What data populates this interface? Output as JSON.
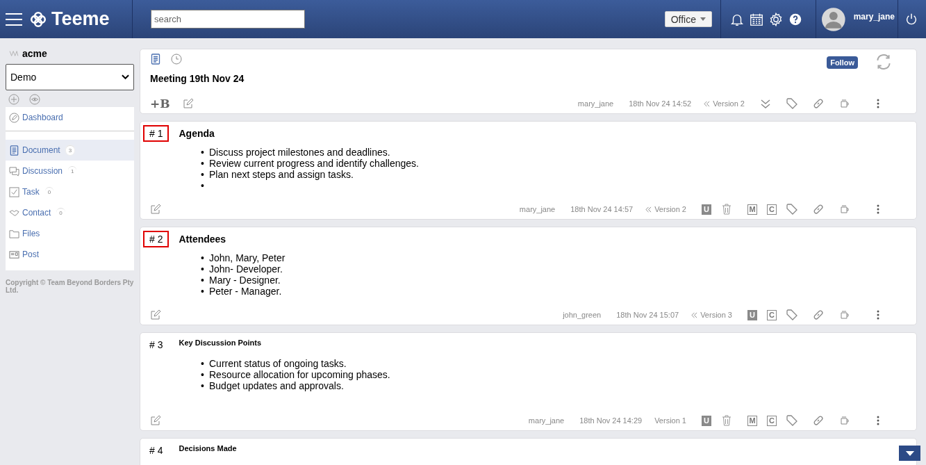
{
  "header": {
    "brand": "Teeme",
    "search": {
      "placeholder": "search"
    },
    "workspace": "Office",
    "user": "mary_jane"
  },
  "sidebar": {
    "org": "acme",
    "project": "Demo",
    "items": [
      {
        "label": "Dashboard",
        "selected": false
      },
      {
        "label": "Document",
        "count": "3",
        "selected": true
      },
      {
        "label": "Discussion",
        "count": "1",
        "selected": false
      },
      {
        "label": "Task",
        "count": "0",
        "selected": false
      },
      {
        "label": "Contact",
        "count": "0",
        "selected": false
      },
      {
        "label": "Files",
        "selected": false
      },
      {
        "label": "Post",
        "selected": false
      }
    ],
    "copyright": "Copyright © Team Beyond Borders Pty Ltd."
  },
  "document": {
    "title": "Meeting 19th Nov 24",
    "follow": "Follow",
    "add_block": "+B",
    "author": "mary_jane",
    "date": "18th Nov 24 14:52",
    "version": "Version 2"
  },
  "sections": [
    {
      "number": "# 1",
      "title": "Agenda",
      "highlighted": true,
      "kind": "major",
      "bullets": [
        {
          "marker": "•",
          "text": "Discuss project milestones and deadlines."
        },
        {
          "marker": "•",
          "text": "Review current progress and identify challenges."
        },
        {
          "marker": "•",
          "text": "Plan next steps and assign tasks."
        },
        {
          "marker": "•"
        }
      ],
      "author": "mary_jane",
      "date": "18th Nov 24 14:57",
      "version": "Version 2",
      "version_history": true,
      "tools": [
        {
          "kind": "letter",
          "text": "U"
        },
        {
          "kind": "trash"
        },
        {
          "kind": "letter",
          "text": "M"
        },
        {
          "kind": "letter",
          "text": "C"
        }
      ]
    },
    {
      "number": "# 2",
      "title": "Attendees",
      "highlighted": true,
      "kind": "major",
      "bullets": [
        {
          "marker": "•",
          "text": "John, Mary, Peter"
        },
        {
          "marker": "•",
          "text": "John- Developer."
        },
        {
          "marker": "•",
          "text": "Mary - Designer."
        },
        {
          "marker": "•",
          "text": "Peter - Manager."
        }
      ],
      "author": "john_green",
      "date": "18th Nov 24 15:07",
      "version": "Version 3",
      "version_history": true,
      "tools": [
        {
          "kind": "letter",
          "text": "U"
        },
        {
          "kind": "letter",
          "text": "C"
        }
      ]
    },
    {
      "number": "# 3",
      "title": "Key Discussion Points",
      "highlighted": false,
      "kind": "minor",
      "bullets": [
        {
          "marker": "•",
          "text": "Current status of ongoing tasks."
        },
        {
          "marker": "•",
          "text": "Resource allocation for upcoming phases."
        },
        {
          "marker": "•",
          "text": "Budget updates and approvals."
        }
      ],
      "author": "mary_jane",
      "date": "18th Nov 24 14:29",
      "version": "Version 1",
      "version_history": false,
      "tools": [
        {
          "kind": "letter",
          "text": "U"
        },
        {
          "kind": "trash"
        },
        {
          "kind": "letter",
          "text": "M"
        },
        {
          "kind": "letter",
          "text": "C"
        }
      ]
    },
    {
      "number": "# 4",
      "title": "Decisions Made",
      "highlighted": false,
      "kind": "minor"
    }
  ]
}
